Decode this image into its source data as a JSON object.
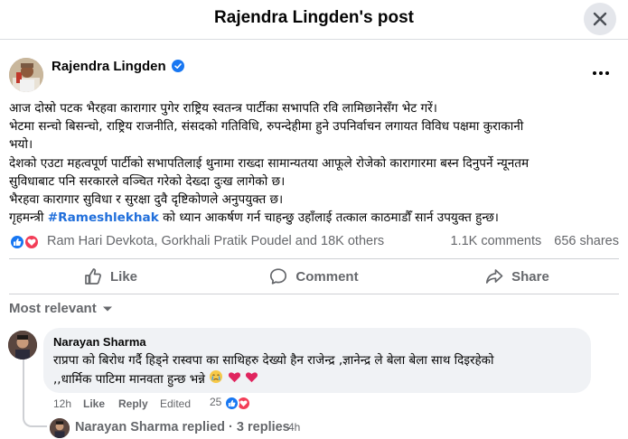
{
  "dialog": {
    "title": "Rajendra Lingden's post"
  },
  "post": {
    "author": "Rajendra Lingden",
    "lines": [
      "आज दोस्रो पटक भैरहवा कारागार पुगेर राष्ट्रिय स्वतन्त्र पार्टीका सभापति रवि लामिछानेसँग भेट गरें।",
      "भेटमा सन्चो बिसन्चो, राष्ट्रिय राजनीति, संसदको गतिविधि, रुपन्देहीमा हुने उपनिर्वाचन लगायत विविध पक्षमा कुराकानी",
      "भयो।",
      "देशको एउटा महत्वपूर्ण पार्टीको सभापतिलाई थुनामा राख्दा सामान्यतया आफूले रोजेको कारागारमा बस्न दिनुपर्ने न्यूनतम",
      "सुविधाबाट पनि सरकारले वञ्चित गरेको देख्दा दुःख लागेको छ।",
      "भैरहवा कारागार सुविधा र सुरक्षा दुवै दृष्टिकोणले अनुपयुक्त छ।"
    ],
    "last_line_prefix": "गृहमन्त्री ",
    "hashtag": "#Rameshlekhak",
    "last_line_suffix": " को ध्यान आकर्षण गर्न चाहन्छु उहाँलाई तत्काल काठमाडौँ सार्न उपयुक्त हुन्छ।"
  },
  "stats": {
    "reactors": "Ram Hari Devkota, Gorkhali Pratik Poudel and 18K others",
    "comments": "1.1K comments",
    "shares": "656 shares"
  },
  "actions": {
    "like": "Like",
    "comment": "Comment",
    "share": "Share"
  },
  "sort": {
    "label": "Most relevant"
  },
  "comment": {
    "author": "Narayan Sharma",
    "line1": "राप्रपा को बिरोध गर्दै हिड्ने रास्वपा का साथिहरु देख्यो हैन राजेन्द्र ,ज्ञानेन्द्र ले बेला बेला साथ दिइरहेको",
    "line2": ",,धार्मिक पाटिमा मानवता हुन्छ भन्ने ",
    "time": "12h",
    "like": "Like",
    "reply": "Reply",
    "edited": "Edited",
    "reaction_count": "25"
  },
  "replies": {
    "summary": "Narayan Sharma replied · 3 replies",
    "time": "4h"
  },
  "colors": {
    "accent": "#1877f2",
    "love": "#f33e58",
    "muted_text": "#65676b",
    "bubble_bg": "#f0f2f5",
    "close_bg": "#e4e6eb"
  }
}
